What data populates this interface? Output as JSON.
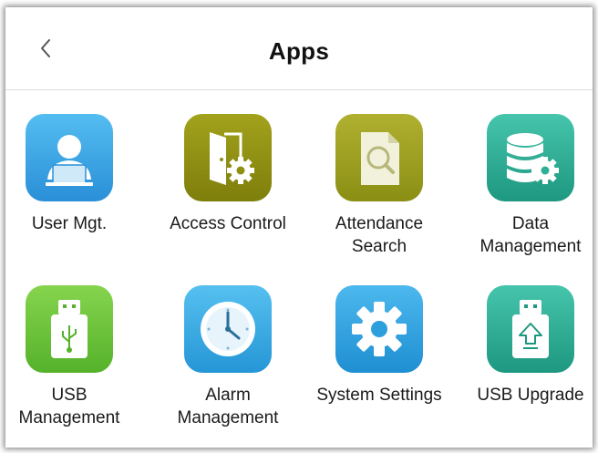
{
  "header": {
    "title": "Apps"
  },
  "apps": [
    {
      "label": "User Mgt.",
      "icon": "user-icon",
      "color": "#3aa3e0"
    },
    {
      "label": "Access Control",
      "icon": "door-gear-icon",
      "color": "#8f8f12"
    },
    {
      "label": "Attendance\nSearch",
      "icon": "document-search-icon",
      "color": "#9aa020"
    },
    {
      "label": "Data\nManagement",
      "icon": "database-gear-icon",
      "color": "#2fae98"
    },
    {
      "label": "USB\nManagement",
      "icon": "usb-drive-icon",
      "color": "#6cc23a"
    },
    {
      "label": "Alarm\nManagement",
      "icon": "clock-icon",
      "color": "#35a8e0"
    },
    {
      "label": "System Settings",
      "icon": "gear-icon",
      "color": "#2c9fdc"
    },
    {
      "label": "USB Upgrade",
      "icon": "usb-upgrade-icon",
      "color": "#2fae98"
    }
  ]
}
